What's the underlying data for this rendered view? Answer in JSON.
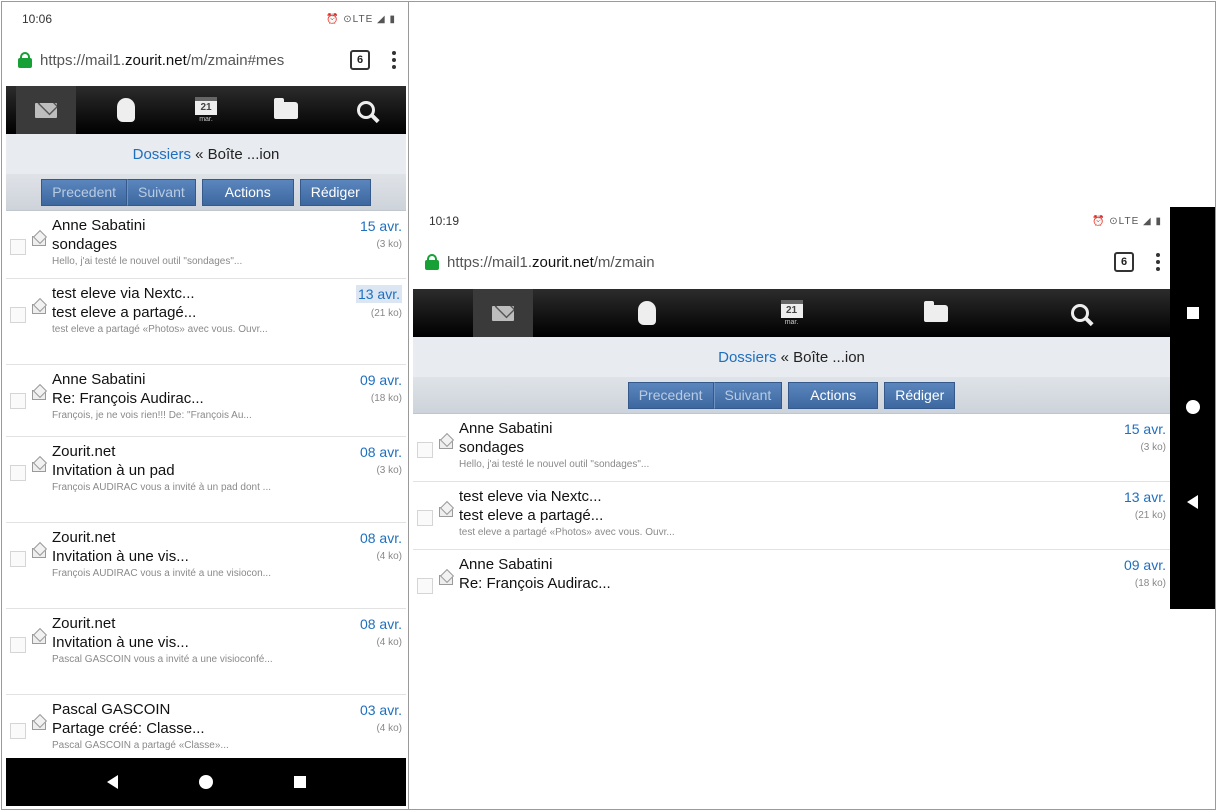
{
  "left_phone": {
    "status_time": "10:06",
    "status_icons": "⏰ ⊙LTE ◢ ▮",
    "url_prefix": "https://mail1.",
    "url_domain": "zourit.net",
    "url_suffix": "/m/zmain#mes",
    "tab_count": "6",
    "calendar_day": "21",
    "calendar_month": "mar.",
    "breadcrumb_link": "Dossiers",
    "breadcrumb_rest": " « Boîte ...ion",
    "buttons": {
      "previous": "Precedent",
      "next": "Suivant",
      "actions": "Actions",
      "compose": "Rédiger"
    },
    "messages": [
      {
        "from": "Anne Sabatini",
        "subject": "sondages",
        "snippet": "Hello, j'ai testé le nouvel outil \"sondages\"...",
        "date": "15 avr.",
        "size": "(3 ko)",
        "highlight": false
      },
      {
        "from": "test eleve via Nextc...",
        "subject": "test eleve a partagé...",
        "snippet": "test eleve a partagé «Photos» avec vous. Ouvr...",
        "date": "13 avr.",
        "size": "(21 ko)",
        "highlight": true
      },
      {
        "from": "Anne Sabatini",
        "subject": "Re: François Audirac...",
        "snippet": "François, je ne vois rien!!! De: \"François Au...",
        "date": "09 avr.",
        "size": "(18 ko)",
        "highlight": false
      },
      {
        "from": "Zourit.net",
        "subject": "Invitation à un pad",
        "snippet": "François AUDIRAC vous a invité à un pad dont ...",
        "date": "08 avr.",
        "size": "(3 ko)",
        "highlight": false
      },
      {
        "from": "Zourit.net",
        "subject": "Invitation à une vis...",
        "snippet": "François AUDIRAC vous a invité a une visiocon...",
        "date": "08 avr.",
        "size": "(4 ko)",
        "highlight": false
      },
      {
        "from": "Zourit.net",
        "subject": "Invitation à une vis...",
        "snippet": "Pascal GASCOIN vous a invité a une visioconfé...",
        "date": "08 avr.",
        "size": "(4 ko)",
        "highlight": false
      },
      {
        "from": "Pascal GASCOIN",
        "subject": "Partage créé: Classe...",
        "snippet": "Pascal GASCOIN a partagé «Classe»...",
        "date": "03 avr.",
        "size": "(4 ko)",
        "highlight": false
      }
    ]
  },
  "right_phone": {
    "status_time": "10:19",
    "status_icons": "⏰ ⊙LTE ◢ ▮",
    "url_prefix": "https://mail1.",
    "url_domain": "zourit.net",
    "url_suffix": "/m/zmain",
    "tab_count": "6",
    "calendar_day": "21",
    "calendar_month": "mar.",
    "breadcrumb_link": "Dossiers",
    "breadcrumb_rest": " « Boîte ...ion",
    "buttons": {
      "previous": "Precedent",
      "next": "Suivant",
      "actions": "Actions",
      "compose": "Rédiger"
    },
    "messages": [
      {
        "from": "Anne Sabatini",
        "subject": "sondages",
        "snippet": "Hello, j'ai testé le nouvel outil \"sondages\"...",
        "date": "15 avr.",
        "size": "(3 ko)"
      },
      {
        "from": "test eleve via Nextc...",
        "subject": "test eleve a partagé...",
        "snippet": "test eleve a partagé «Photos» avec vous. Ouvr...",
        "date": "13 avr.",
        "size": "(21 ko)"
      },
      {
        "from": "Anne Sabatini",
        "subject": "Re: François Audirac...",
        "snippet": "",
        "date": "09 avr.",
        "size": "(18 ko)"
      }
    ]
  },
  "colors": {
    "link": "#1f6fbf",
    "button": "#3d689f",
    "lock": "#17a035",
    "navbar": "#000000"
  }
}
